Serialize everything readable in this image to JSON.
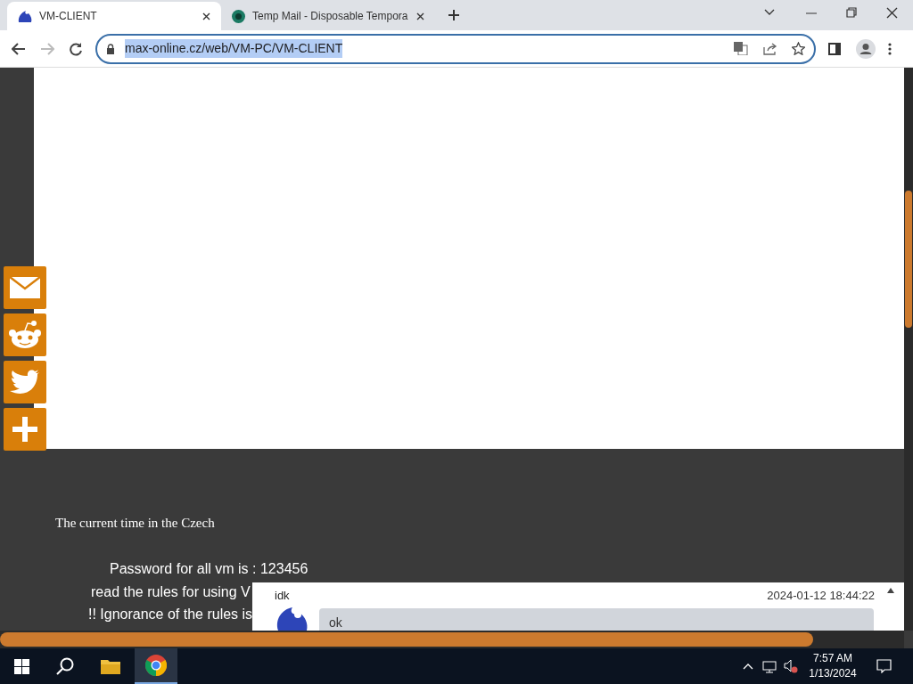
{
  "tabs": [
    {
      "title": "VM-CLIENT",
      "selected": true,
      "kind": "flame"
    },
    {
      "title": "Temp Mail - Disposable Tempora",
      "selected": false,
      "kind": "mail"
    }
  ],
  "address_bar": {
    "url": "max-online.cz/web/VM-PC/VM-CLIENT",
    "selected_text": true
  },
  "share_bar": [
    {
      "kind": "mail"
    },
    {
      "kind": "reddit"
    },
    {
      "kind": "twitter"
    },
    {
      "kind": "plus"
    }
  ],
  "page": {
    "time_text": "The current time in the Czech",
    "lines": [
      "Password for all vm is : 123456",
      "read the rules for using V",
      "!! Ignorance of the rules is"
    ]
  },
  "chat": {
    "author": "idk",
    "timestamp": "2024-01-12 18:44:22",
    "message": "ok"
  },
  "taskbar": {
    "time": "7:57 AM",
    "date": "1/13/2024"
  }
}
